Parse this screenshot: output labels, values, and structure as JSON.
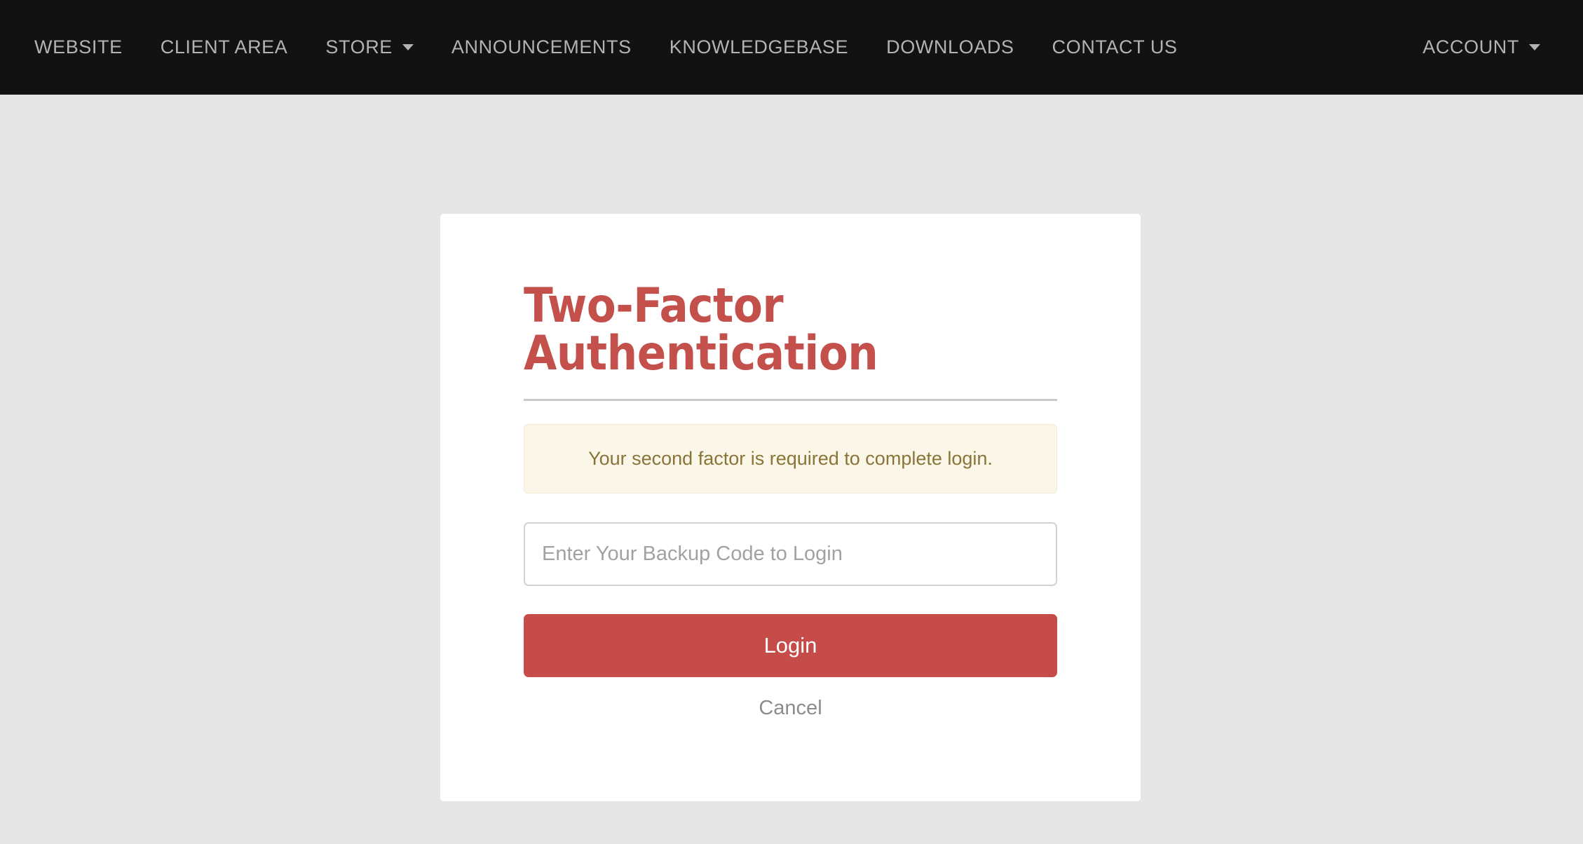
{
  "colors": {
    "navbar_bg": "#121212",
    "navbar_text": "#b3b3b3",
    "page_bg": "#e6e6e6",
    "card_bg": "#ffffff",
    "brand_red": "#c64c49",
    "title_red": "#c4504c",
    "alert_bg": "#faf7e8",
    "alert_border": "#f2ecd2",
    "alert_text": "#8a7438",
    "muted_text": "#8c8c8c"
  },
  "navbar": {
    "left_items": [
      {
        "label": "WEBSITE",
        "has_caret": false,
        "caret_icon": ""
      },
      {
        "label": "CLIENT AREA",
        "has_caret": false,
        "caret_icon": ""
      },
      {
        "label": "STORE",
        "has_caret": true,
        "caret_icon": "chevron-down-icon"
      },
      {
        "label": "ANNOUNCEMENTS",
        "has_caret": false,
        "caret_icon": ""
      },
      {
        "label": "KNOWLEDGEBASE",
        "has_caret": false,
        "caret_icon": ""
      },
      {
        "label": "DOWNLOADS",
        "has_caret": false,
        "caret_icon": ""
      },
      {
        "label": "CONTACT US",
        "has_caret": false,
        "caret_icon": ""
      }
    ],
    "right_items": [
      {
        "label": "ACCOUNT",
        "has_caret": true,
        "caret_icon": "chevron-down-icon"
      }
    ]
  },
  "card": {
    "title": "Two-Factor Authentication",
    "alert_message": "Your second factor is required to complete login.",
    "code_input": {
      "value": "",
      "placeholder": "Enter Your Backup Code to Login"
    },
    "login_label": "Login",
    "cancel_label": "Cancel"
  }
}
